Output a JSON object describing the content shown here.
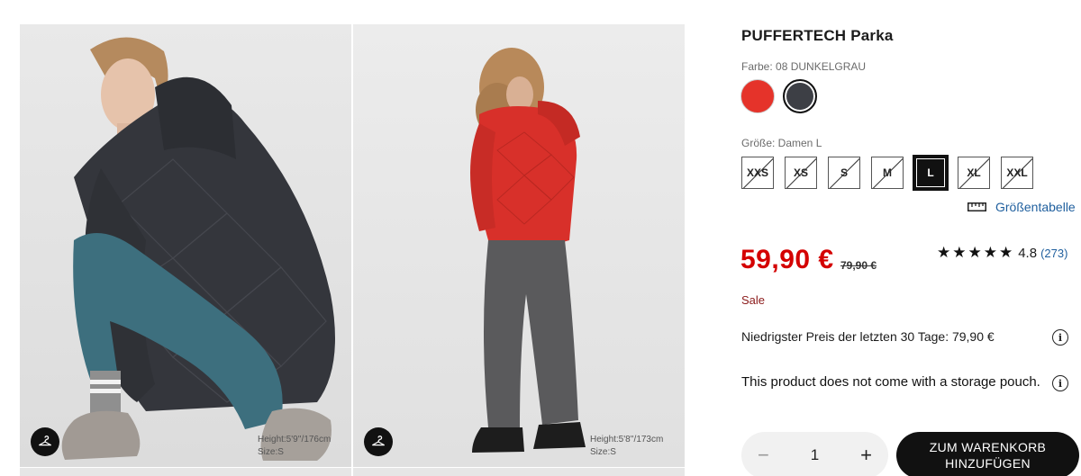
{
  "product": {
    "title": "PUFFERTECH Parka",
    "color_label": "Farbe: 08 DUNKELGRAU",
    "colors": [
      {
        "name": "red",
        "hex": "#e5332a",
        "selected": false
      },
      {
        "name": "dark-grey",
        "hex": "#3d3f45",
        "selected": true
      }
    ],
    "size_label": "Größe: Damen L",
    "sizes": [
      {
        "label": "XXS",
        "available": false,
        "selected": false
      },
      {
        "label": "XS",
        "available": false,
        "selected": false
      },
      {
        "label": "S",
        "available": false,
        "selected": false
      },
      {
        "label": "M",
        "available": false,
        "selected": false
      },
      {
        "label": "L",
        "available": true,
        "selected": true
      },
      {
        "label": "XL",
        "available": false,
        "selected": false
      },
      {
        "label": "XXL",
        "available": false,
        "selected": false
      }
    ],
    "size_table_link": "Größentabelle",
    "size_table_icon": "ruler-icon",
    "price": "59,90 €",
    "old_price": "79,90 €",
    "sale_label": "Sale",
    "rating": {
      "stars": "★★★★★",
      "value": "4.8",
      "count": "(273)",
      "score": 4.8
    },
    "lowest_price_text": "Niedrigster Preis der letzten 30 Tage: 79,90 €",
    "storage_note": "This product does not come with a storage pouch.",
    "info_icon_glyph": "i",
    "quantity": {
      "minus": "−",
      "value": "1",
      "plus": "+"
    },
    "add_to_cart": "ZUM WARENKORB HINZUFÜGEN"
  },
  "gallery": [
    {
      "model_height": "Height:5'9''/176cm",
      "model_size": "Size:S",
      "jacket_color": "#34363c",
      "hanger_icon": "hanger-icon"
    },
    {
      "model_height": "Height:5'8''/173cm",
      "model_size": "Size:S",
      "jacket_color": "#d8302a",
      "hanger_icon": "hanger-icon"
    }
  ],
  "colors": {
    "price_red": "#d40000",
    "link_blue": "#1f5f9e",
    "sale_text": "#8b1a1a",
    "button_black": "#111111"
  }
}
